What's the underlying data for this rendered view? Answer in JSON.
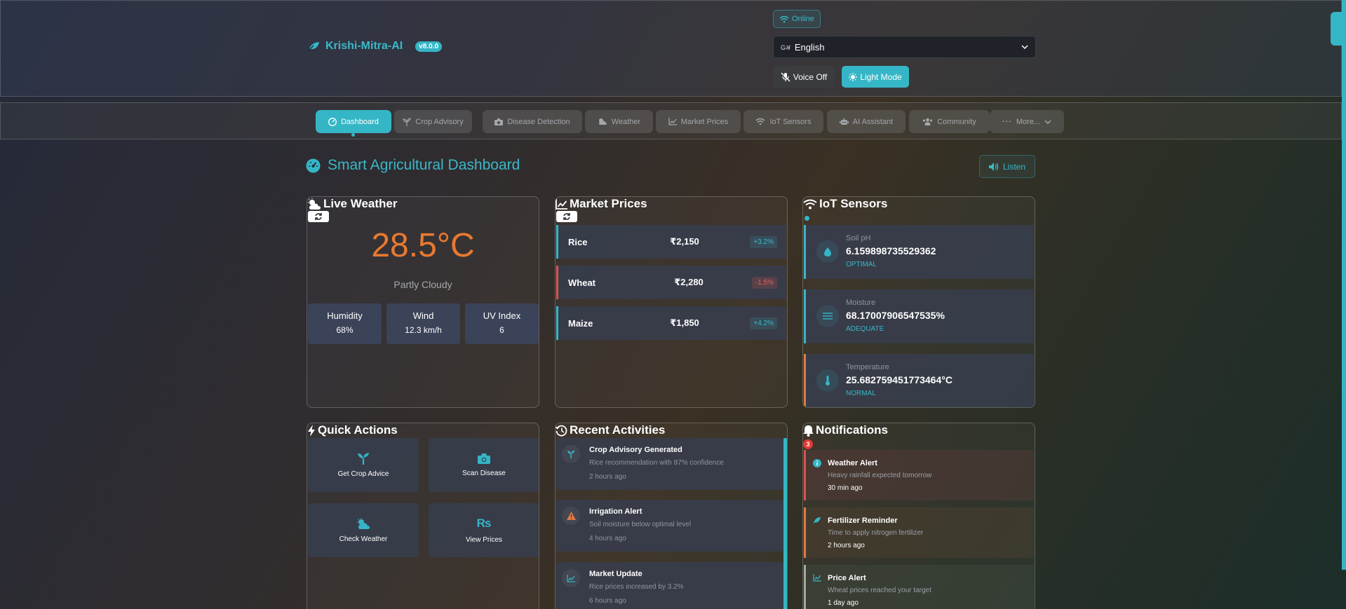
{
  "header": {
    "brand_name": "Krishi-Mitra-AI",
    "version": "v8.0.0",
    "status": "Online",
    "language_selected": "English",
    "voice_label": "Voice Off",
    "theme_label": "Light Mode"
  },
  "nav": {
    "items": [
      {
        "label": "Dashboard",
        "icon": "gauge-icon",
        "active": true
      },
      {
        "label": "Crop Advisory",
        "icon": "seedling-icon"
      },
      {
        "label": "Disease Detection",
        "icon": "camera-icon"
      },
      {
        "label": "Weather",
        "icon": "cloud-sun-icon"
      },
      {
        "label": "Market Prices",
        "icon": "chart-line-icon"
      },
      {
        "label": "IoT Sensors",
        "icon": "wifi-icon"
      },
      {
        "label": "AI Assistant",
        "icon": "robot-icon"
      },
      {
        "label": "Community",
        "icon": "users-icon"
      },
      {
        "label": "More...",
        "icon": "ellipsis-icon"
      }
    ]
  },
  "page": {
    "title": "Smart Agricultural Dashboard",
    "listen_label": "Listen"
  },
  "weather": {
    "title": "Live Weather",
    "temperature": "28.5°C",
    "condition": "Partly Cloudy",
    "stats": [
      {
        "label": "Humidity",
        "value": "68%"
      },
      {
        "label": "Wind",
        "value": "12.3 km/h"
      },
      {
        "label": "UV Index",
        "value": "6"
      }
    ]
  },
  "market": {
    "title": "Market Prices",
    "rows": [
      {
        "name": "Rice",
        "price": "₹2,150",
        "change": "+3.2%",
        "trend": "up"
      },
      {
        "name": "Wheat",
        "price": "₹2,280",
        "change": "-1.5%",
        "trend": "down"
      },
      {
        "name": "Maize",
        "price": "₹1,850",
        "change": "+4.2%",
        "trend": "up"
      }
    ]
  },
  "iot": {
    "title": "IoT Sensors",
    "sensors": [
      {
        "label": "Soil pH",
        "value": "6.159898735529362",
        "status": "OPTIMAL",
        "icon": "droplet-icon"
      },
      {
        "label": "Moisture",
        "value": "68.17007906547535%",
        "status": "ADEQUATE",
        "icon": "water-lines-icon"
      },
      {
        "label": "Temperature",
        "value": "25.682759451773464°C",
        "status": "NORMAL",
        "icon": "thermometer-icon"
      }
    ]
  },
  "quick_actions": {
    "title": "Quick Actions",
    "items": [
      {
        "label": "Get Crop Advice",
        "icon": "seedling-icon"
      },
      {
        "label": "Scan Disease",
        "icon": "camera-icon"
      },
      {
        "label": "Check Weather",
        "icon": "cloud-sun-icon"
      },
      {
        "label": "View Prices",
        "icon": "rupee-icon"
      }
    ]
  },
  "activities": {
    "title": "Recent Activities",
    "items": [
      {
        "title": "Crop Advisory Generated",
        "desc": "Rice recommendation with 87% confidence",
        "time": "2 hours ago"
      },
      {
        "title": "Irrigation Alert",
        "desc": "Soil moisture below optimal level",
        "time": "4 hours ago"
      },
      {
        "title": "Market Update",
        "desc": "Rice prices increased by 3.2%",
        "time": "6 hours ago"
      }
    ]
  },
  "notifications": {
    "title": "Notifications",
    "count": "3",
    "items": [
      {
        "title": "Weather Alert",
        "desc": "Heavy rainfall expected tomorrow",
        "time": "30 min ago"
      },
      {
        "title": "Fertilizer Reminder",
        "desc": "Time to apply nitrogen fertilizer",
        "time": "2 hours ago"
      },
      {
        "title": "Price Alert",
        "desc": "Wheat prices reached your target",
        "time": "1 day ago"
      }
    ]
  },
  "colors": {
    "accent": "#35b6c6",
    "temperature": "#e87a30",
    "danger": "#d9534f"
  }
}
